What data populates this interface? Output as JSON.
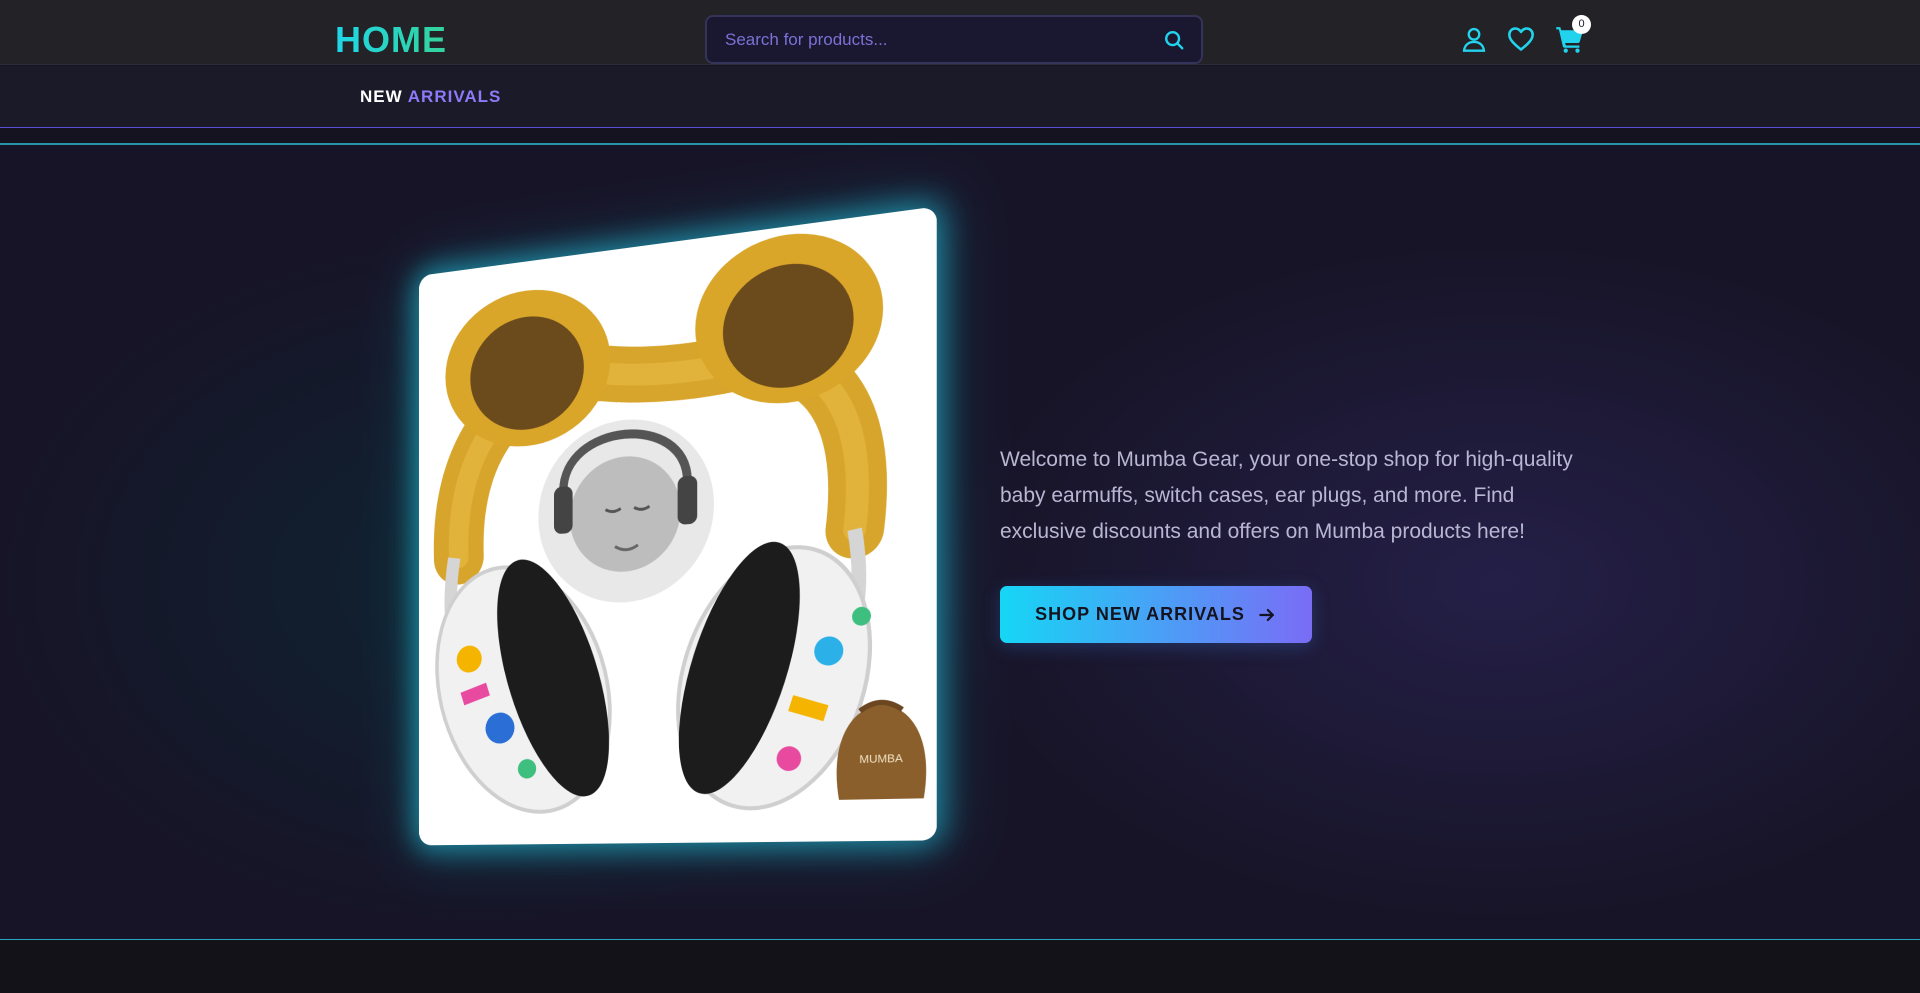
{
  "header": {
    "logo": "HOME",
    "search": {
      "placeholder": "Search for products...",
      "value": ""
    },
    "icons": [
      "user-icon",
      "heart-icon",
      "cart-icon"
    ],
    "cart_count": "0"
  },
  "nav": {
    "items": [
      {
        "label_primary": "NEW",
        "label_accent": "ARRIVALS"
      }
    ]
  },
  "hero": {
    "image_alt": "Mumba baby earmuffs with bear ears",
    "image_pouch_text": "MUMBA",
    "description": "Welcome to Mumba Gear, your one-stop shop for high-quality baby earmuffs, switch cases, ear plugs, and more. Find exclusive discounts and offers on Mumba products here!",
    "cta_label": "SHOP NEW ARRIVALS"
  },
  "colors": {
    "accent_cyan": "#22d3ee",
    "accent_purple": "#8b7bf8",
    "background": "#15131f"
  }
}
